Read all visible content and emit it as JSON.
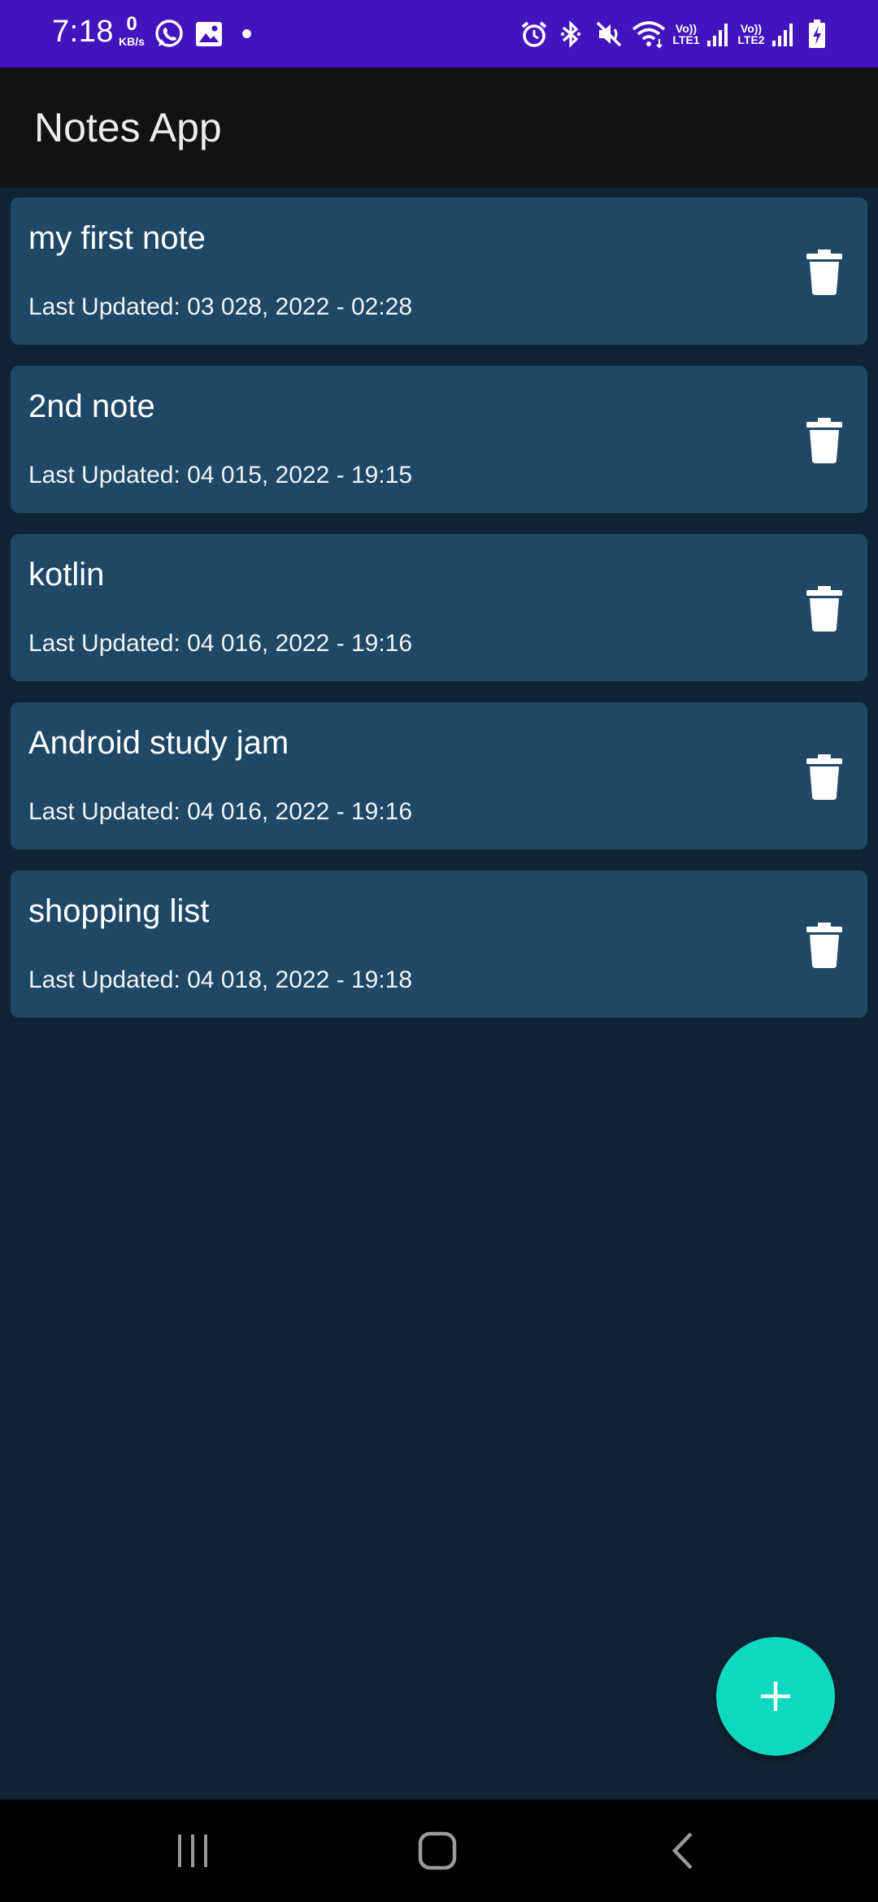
{
  "status_bar": {
    "time": "7:18",
    "net_speed_value": "0",
    "net_speed_unit": "KB/s",
    "sim1_label_top": "Vo))",
    "sim1_label_bottom": "LTE1",
    "sim2_label_top": "Vo))",
    "sim2_label_bottom": "LTE2",
    "background_color": "#4313be"
  },
  "app_bar": {
    "title": "Notes App"
  },
  "notes": [
    {
      "title": "my first note",
      "date": "Last Updated: 03 028, 2022 - 02:28"
    },
    {
      "title": "2nd note",
      "date": "Last Updated: 04 015, 2022 - 19:15"
    },
    {
      "title": "kotlin",
      "date": "Last Updated: 04 016, 2022 - 19:16"
    },
    {
      "title": "Android study jam",
      "date": "Last Updated: 04 016, 2022 - 19:16"
    },
    {
      "title": "shopping list",
      "date": "Last Updated: 04 018, 2022 - 19:18"
    }
  ],
  "icons": {
    "delete": "trash-icon",
    "fab": "plus-icon",
    "nav_recents": "recents-icon",
    "nav_home": "home-icon",
    "nav_back": "back-icon"
  },
  "colors": {
    "background": "#112435",
    "card": "#1f4866",
    "app_bar": "#121212",
    "fab": "#0fd8c0"
  }
}
